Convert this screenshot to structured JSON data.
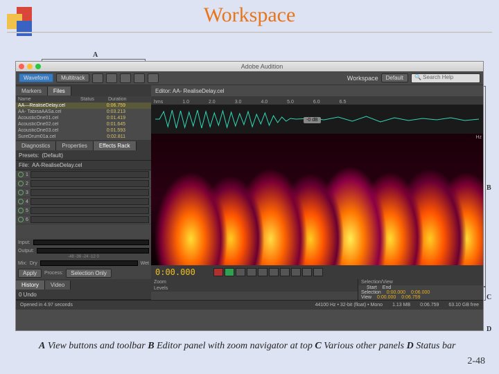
{
  "slide": {
    "title": "Workspace",
    "pagenum": "2-48",
    "caption_parts": {
      "a_label": "A",
      "a_text": " View buttons and toolbar ",
      "b_label": "B",
      "b_text": " Editor panel with zoom navigator at top ",
      "c_label": "C",
      "c_text": " Various other panels ",
      "d_label": "D",
      "d_text": " Status bar"
    }
  },
  "app": {
    "title": "Adobe Audition",
    "callouts": {
      "A": "A",
      "B": "B",
      "C": "C",
      "D": "D"
    },
    "toolbar": {
      "waveform": "Waveform",
      "multitrack": "Multitrack",
      "workspace_label": "Workspace",
      "workspace_value": "Default",
      "search_placeholder": "Search Help"
    },
    "tabs_left": {
      "markers": "Markers",
      "files": "Files"
    },
    "files": {
      "col_name": "Name",
      "col_status": "Status",
      "col_duration": "Duration",
      "rows": [
        {
          "name": "AA—RealiseDelay.cel",
          "dur": "0:06.759"
        },
        {
          "name": "AA- TabisaAASa.cel",
          "dur": "0:03.213"
        },
        {
          "name": "AcousticOne01.cel",
          "dur": "0:01.419"
        },
        {
          "name": "AcousticOne02.cel",
          "dur": "0:01.645"
        },
        {
          "name": "AcousticOne03.cel",
          "dur": "0:01.593"
        },
        {
          "name": "SureDrum01a.cel",
          "dur": "0:02.811"
        }
      ]
    },
    "midtabs": {
      "diagnostics": "Diagnostics",
      "properties": "Properties",
      "effects": "Effects Rack"
    },
    "effects": {
      "preset_label": "Presets:",
      "preset_value": "(Default)",
      "file_label": "File:",
      "file_value": "AA-RealiseDelay.cel",
      "slots": [
        "1",
        "2",
        "3",
        "4",
        "5",
        "6"
      ],
      "input": "Input:",
      "output": "Output:",
      "ticks": "-48  -36  -24  -12  0",
      "mix": "Mix:",
      "dry": "Dry",
      "wet": "Wet",
      "apply": "Apply",
      "process": "Process:",
      "selection": "Selection Only"
    },
    "bottom_tabs": {
      "history": "History",
      "video": "Video"
    },
    "history_val": "0 Undo",
    "status_open": "Opened in 4.97 seconds",
    "editor": {
      "tab": "Editor: AA- RealiseDelay.cel",
      "hms": [
        "hms",
        "",
        "1.0",
        "",
        "2.0",
        "",
        "3.0",
        "",
        "4.0",
        "",
        "5.0",
        "",
        "6.0",
        "6.5"
      ],
      "db_tag": "-0 dB",
      "hz": "Hz",
      "timecode": "0:00.000",
      "zoom": "Zoom",
      "levels": "Levels",
      "selview": "Selection/View",
      "start": "Start",
      "end": "End",
      "sel_start": "0:00.000",
      "sel_end": "0:06.000",
      "view_label": "View",
      "view_start": "0:00.000",
      "view_end": "0:06.759"
    },
    "status": {
      "format": "44100 Hz • 32-bit (float) • Mono",
      "size": "1.13 MB",
      "dur": "0:06.759",
      "free": "63.10 GB free"
    }
  }
}
